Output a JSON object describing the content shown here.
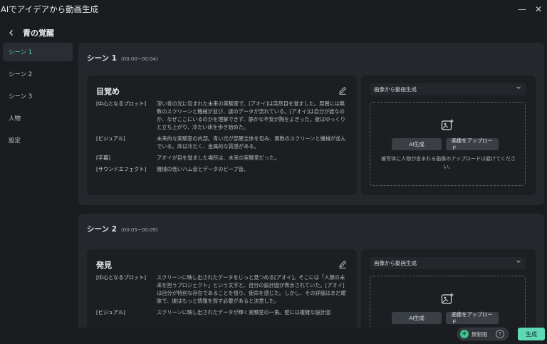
{
  "window": {
    "title": "AIでアイデアから動画生成",
    "minimize_glyph": "—",
    "close_glyph": "✕"
  },
  "header": {
    "title": "青の覚醒"
  },
  "sidebar": {
    "items": [
      {
        "label": "シーン 1",
        "active": true
      },
      {
        "label": "シーン 2",
        "active": false
      },
      {
        "label": "シーン 3",
        "active": false
      },
      {
        "label": "人物",
        "active": false
      },
      {
        "label": "設定",
        "active": false
      }
    ]
  },
  "scenes": [
    {
      "title": "シーン 1",
      "time": "(00:00~00:04)",
      "card": {
        "title": "目覚め",
        "rows": [
          {
            "label": "[中心となるプロット]",
            "text": "深い青の光に包まれた未来の実験室で、[アオイ]は突然目を覚ました。周囲には無数のスクリーンと機械が並び、謎のデータが流れている。[アオイ]は自分が誰なのか、なぜここにいるのかを理解できず、静かな不安が胸をよぎった。彼はゆっくりと立ち上がり、冷たい床を歩き始めた。"
          },
          {
            "label": "[ビジュアル]",
            "text": "未来的な実験室の内部。青い光が部屋全体を包み、無数のスクリーンと機械が並んでいる。床は冷たく、金属的な質感がある。"
          },
          {
            "label": "[字幕]",
            "text": "アオイが目を覚ました場所は、未来の実験室だった。"
          },
          {
            "label": "[サウンドエフェクト]",
            "text": "機械の低いハム音とデータのビープ音。"
          }
        ]
      },
      "panel": {
        "select": "画像から動画生成",
        "ai_button": "AI生成",
        "upload_button": "画像をアップロード",
        "note": "被写体に人物が含まれる画像のアップロードは避けてください。"
      }
    },
    {
      "title": "シーン 2",
      "time": "(00:05~00:09)",
      "card": {
        "title": "発見",
        "rows": [
          {
            "label": "[中心となるプロット]",
            "text": "スクリーンに映し出されたデータをじっと見つめる[アオイ]。そこには「人類の未来を担うプロジェクト」という文字と、自分の設計図が表示されていた。[アオイ]は自分が特別な存在であることを悟り、使命を感じた。しかし、その詳細はまだ曖昧で、彼はもっと情報を探す必要があると決意した。"
          },
          {
            "label": "[ビジュアル]",
            "text": "スクリーンに映し出されたデータが輝く実験室の一角。壁には複雑な設計図"
          }
        ]
      },
      "panel": {
        "select": "画像から動画生成",
        "ai_button": "AI生成",
        "upload_button": "画像をアップロード"
      }
    }
  ],
  "footer": {
    "badge": "無制限",
    "generate": "生成"
  },
  "colors": {
    "accent": "#5fd8b6",
    "active_text": "#4fd3b0",
    "background": "#1a1c20"
  }
}
